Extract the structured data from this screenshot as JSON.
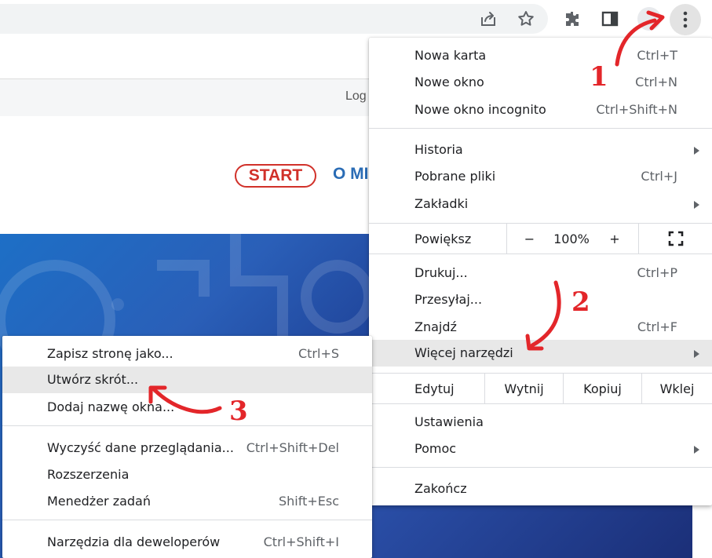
{
  "toolbar": {
    "icons": [
      "share-icon",
      "star-icon",
      "extensions-icon",
      "side-panel-icon",
      "more-vert-icon"
    ]
  },
  "page": {
    "login_text": "Log",
    "start_button": "START",
    "nav_text": "O MI"
  },
  "main_menu": {
    "new_tab": {
      "label": "Nowa karta",
      "shortcut": "Ctrl+T"
    },
    "new_window": {
      "label": "Nowe okno",
      "shortcut": "Ctrl+N"
    },
    "new_incognito": {
      "label": "Nowe okno incognito",
      "shortcut": "Ctrl+Shift+N"
    },
    "history": {
      "label": "Historia"
    },
    "downloads": {
      "label": "Pobrane pliki",
      "shortcut": "Ctrl+J"
    },
    "bookmarks": {
      "label": "Zakładki"
    },
    "zoom": {
      "label": "Powiększ",
      "minus": "−",
      "value": "100%",
      "plus": "+"
    },
    "print": {
      "label": "Drukuj...",
      "shortcut": "Ctrl+P"
    },
    "cast": {
      "label": "Przesyłaj..."
    },
    "find": {
      "label": "Znajdź",
      "shortcut": "Ctrl+F"
    },
    "more_tools": {
      "label": "Więcej narzędzi"
    },
    "edit": {
      "label": "Edytuj",
      "cut": "Wytnij",
      "copy": "Kopiuj",
      "paste": "Wklej"
    },
    "settings": {
      "label": "Ustawienia"
    },
    "help": {
      "label": "Pomoc"
    },
    "exit": {
      "label": "Zakończ"
    }
  },
  "sub_menu": {
    "save_page": {
      "label": "Zapisz stronę jako...",
      "shortcut": "Ctrl+S"
    },
    "create_shortcut": {
      "label": "Utwórz skrót..."
    },
    "name_window": {
      "label": "Dodaj nazwę okna..."
    },
    "clear_data": {
      "label": "Wyczyść dane przeglądania...",
      "shortcut": "Ctrl+Shift+Del"
    },
    "extensions": {
      "label": "Rozszerzenia"
    },
    "task_manager": {
      "label": "Menedżer zadań",
      "shortcut": "Shift+Esc"
    },
    "dev_tools": {
      "label": "Narzędzia dla deweloperów",
      "shortcut": "Ctrl+Shift+I"
    }
  },
  "annotations": {
    "step1": "1",
    "step2": "2",
    "step3": "3",
    "color": "#e3262a"
  }
}
